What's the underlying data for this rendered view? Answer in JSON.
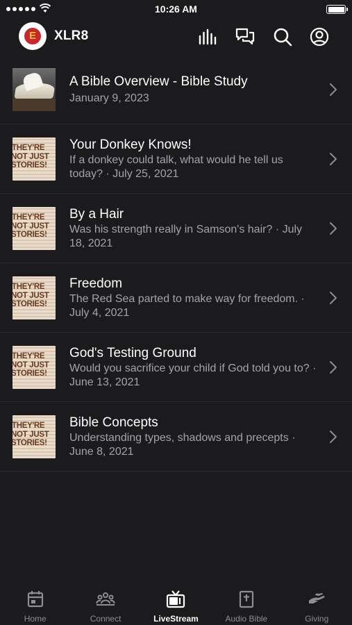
{
  "status_bar": {
    "time": "10:26 AM"
  },
  "header": {
    "logo_letter": "E",
    "app_title": "XLR8",
    "icons": [
      "equalizer-icon",
      "chat-icon",
      "search-icon",
      "profile-icon"
    ]
  },
  "thumbnail_text": {
    "line1": "THEY'RE",
    "line2": "NOT JUST",
    "line3": "STORIES!"
  },
  "items": [
    {
      "title": "A Bible Overview - Bible Study",
      "subtitle": "January 9, 2023",
      "thumbnail": "bible-book"
    },
    {
      "title": "Your Donkey Knows!",
      "subtitle": "If a donkey could talk, what would he tell us today? · July 25, 2021",
      "thumbnail": "not-just-stories"
    },
    {
      "title": "By a Hair",
      "subtitle": "Was his strength really in Samson's hair? · July 18, 2021",
      "thumbnail": "not-just-stories"
    },
    {
      "title": "Freedom",
      "subtitle": "The Red Sea parted to make way for freedom. · July 4, 2021",
      "thumbnail": "not-just-stories"
    },
    {
      "title": "God's Testing Ground",
      "subtitle": "Would you sacrifice your child if God told you to? · June 13, 2021",
      "thumbnail": "not-just-stories"
    },
    {
      "title": "Bible Concepts",
      "subtitle": "Understanding types, shadows and precepts · June 8, 2021",
      "thumbnail": "not-just-stories"
    }
  ],
  "tabs": [
    {
      "label": "Home",
      "icon": "calendar-icon",
      "active": false
    },
    {
      "label": "Connect",
      "icon": "group-icon",
      "active": false
    },
    {
      "label": "LiveStream",
      "icon": "tv-icon",
      "active": true
    },
    {
      "label": "Audio Bible",
      "icon": "bible-icon",
      "active": false
    },
    {
      "label": "Giving",
      "icon": "giving-hand-icon",
      "active": false
    }
  ],
  "colors": {
    "background": "#1b1b1d",
    "text_primary": "#ffffff",
    "text_secondary": "#a4a4a8",
    "tab_inactive": "#8e8e93",
    "logo_red": "#c8282a"
  }
}
